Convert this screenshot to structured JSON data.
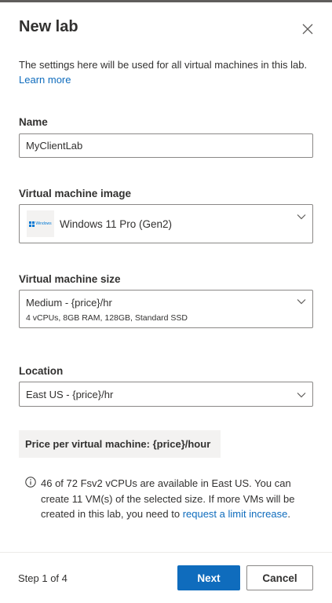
{
  "dialog": {
    "title": "New lab",
    "intro_text": "The settings here will be used for all virtual machines in this lab.",
    "learn_more": "Learn more"
  },
  "form": {
    "name_label": "Name",
    "name_value": "MyClientLab",
    "image_label": "Virtual machine image",
    "image_value": "Windows 11 Pro (Gen2)",
    "image_logo_text": "Windows",
    "size_label": "Virtual machine size",
    "size_value": "Medium - {price}/hr",
    "size_detail": "4 vCPUs, 8GB RAM, 128GB, Standard SSD",
    "location_label": "Location",
    "location_value": "East US - {price}/hr"
  },
  "price": {
    "text": "Price per virtual machine: {price}/hour"
  },
  "info": {
    "text": "46 of 72 Fsv2 vCPUs are available in East US. You can create 11 VM(s) of the selected size. If more VMs will be created in this lab, you need to",
    "link": "request a limit increase",
    "suffix": "."
  },
  "footer": {
    "step": "Step 1 of 4",
    "next": "Next",
    "cancel": "Cancel"
  },
  "colors": {
    "accent": "#0f6cbd",
    "text": "#323130",
    "border": "#8a8886",
    "price_bg": "#f3f2f1"
  },
  "icons": [
    "close-icon",
    "chevron-down-icon",
    "windows-logo",
    "info-icon"
  ]
}
